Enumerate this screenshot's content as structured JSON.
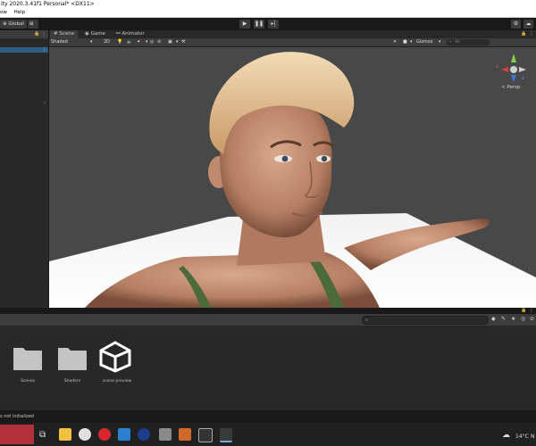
{
  "window": {
    "title": "ity 2020.3.41f1 Personal* <DX11>"
  },
  "menu": {
    "items": [
      "ow",
      "Help"
    ]
  },
  "toolbar": {
    "global_label": "Global"
  },
  "scene": {
    "tabs": [
      "Scene",
      "Game",
      "Animator"
    ],
    "shading_mode": "Shaded",
    "mode_2d": "2D",
    "gizmos_label": "Gizmos",
    "search_placeholder": "All",
    "persp_label": "< Persp",
    "axis_x": "x",
    "axis_z": "z"
  },
  "project": {
    "assets": [
      {
        "name": "Scenes",
        "icon": "folder-icon"
      },
      {
        "name": "Shaders",
        "icon": "folder-icon"
      },
      {
        "name": "scene preview",
        "icon": "unity-logo-icon"
      }
    ]
  },
  "status": {
    "text": "s not initialized"
  },
  "taskbar": {
    "weather": "14°C",
    "clock_partial": "N"
  },
  "colors": {
    "accent_selection": "#2c5d87",
    "play_bar": "#191919",
    "panel": "#3c3c3c"
  }
}
